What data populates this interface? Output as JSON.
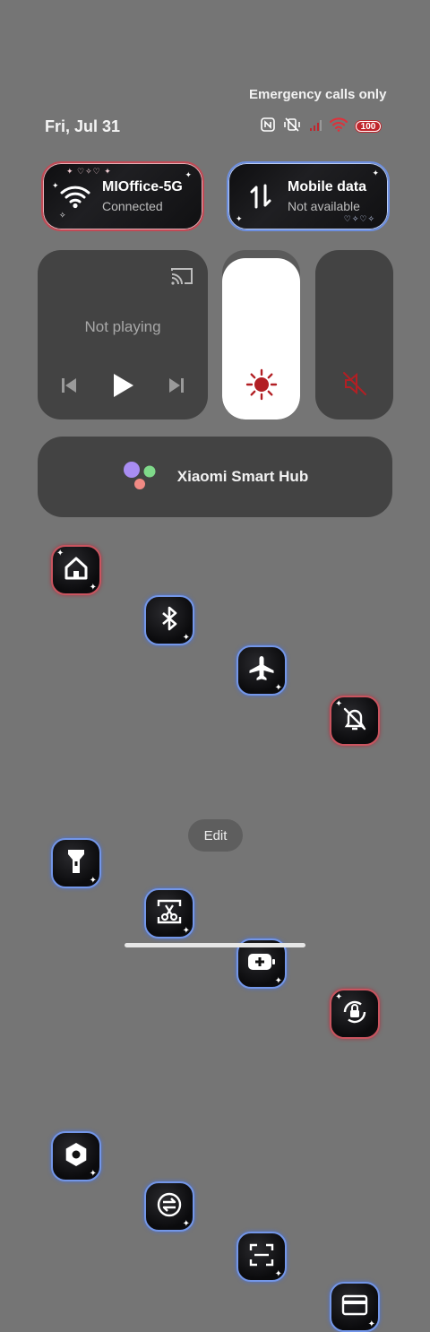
{
  "status": {
    "emergency": "Emergency calls only",
    "date": "Fri, Jul 31",
    "battery": "100",
    "icons": [
      "nfc-icon",
      "vibrate-off-icon",
      "cell-signal-icon",
      "wifi-icon",
      "battery-icon"
    ]
  },
  "wifi_tile": {
    "title": "MIOffice-5G",
    "subtitle": "Connected",
    "icon": "wifi-icon"
  },
  "mobile_tile": {
    "title": "Mobile data",
    "subtitle": "Not available",
    "icon": "mobile-data-icon"
  },
  "media": {
    "status": "Not playing"
  },
  "brightness": {
    "level": 0.95
  },
  "hub": {
    "label": "Xiaomi Smart Hub"
  },
  "toggles": [
    {
      "icon": "home-icon",
      "style": "red"
    },
    {
      "icon": "bluetooth-icon",
      "style": "blue"
    },
    {
      "icon": "airplane-icon",
      "style": "blue"
    },
    {
      "icon": "bell-off-icon",
      "style": "red"
    },
    {
      "icon": "flashlight-icon",
      "style": "blue"
    },
    {
      "icon": "screenshot-scissors-icon",
      "style": "blue"
    },
    {
      "icon": "battery-saver-icon",
      "style": "blue"
    },
    {
      "icon": "rotation-lock-icon",
      "style": "red"
    },
    {
      "icon": "settings-hex-icon",
      "style": "blue"
    },
    {
      "icon": "sync-icon",
      "style": "blue"
    },
    {
      "icon": "scanner-icon",
      "style": "blue"
    },
    {
      "icon": "card-icon",
      "style": "blue"
    }
  ],
  "edit_label": "Edit",
  "colors": {
    "background": "#757575",
    "accent_red": "#c0262d",
    "tile_blue": "#7396e8",
    "tile_red": "#c9545f"
  }
}
